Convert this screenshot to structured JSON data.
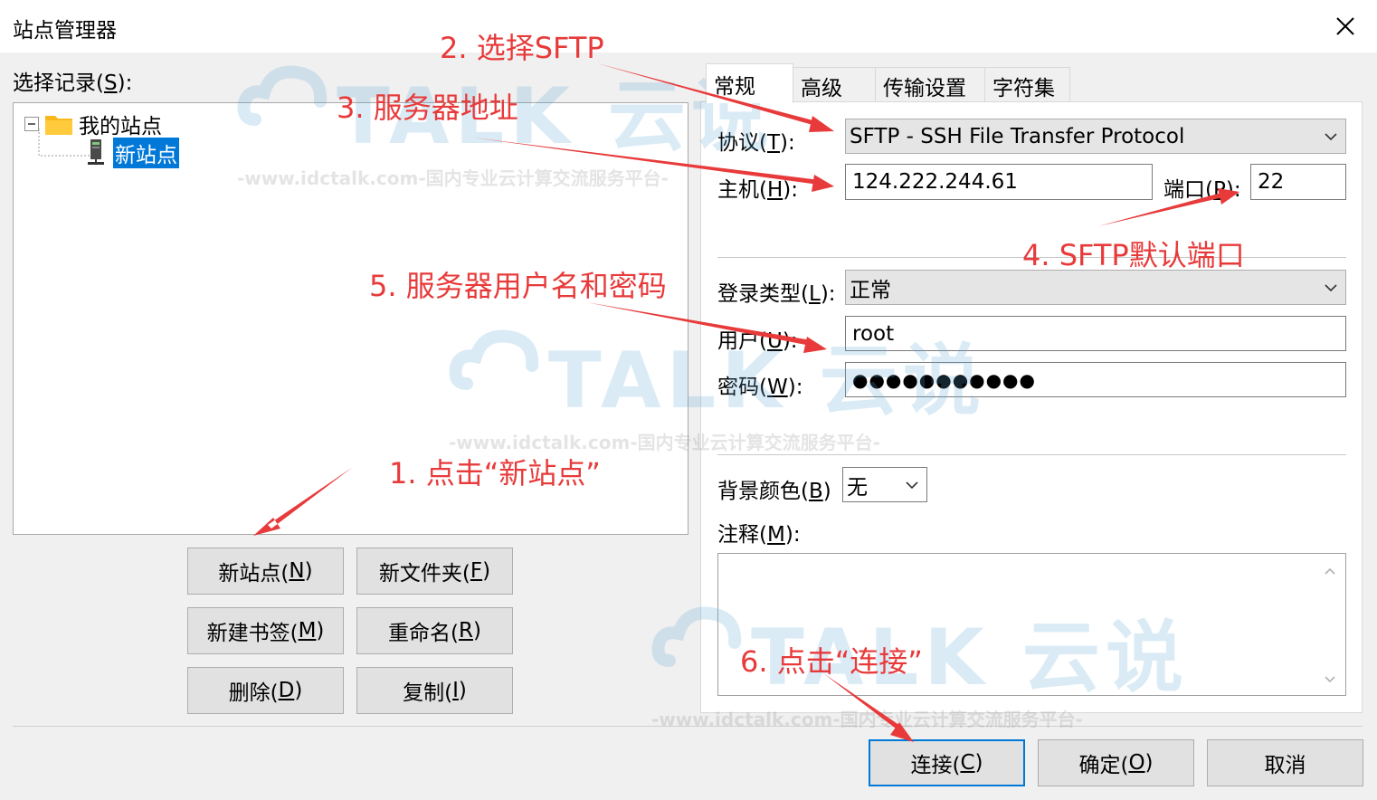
{
  "window": {
    "title": "站点管理器"
  },
  "tree": {
    "label": "选择记录(",
    "label_key": "S",
    "label_end": "):",
    "root": "我的站点",
    "child": "新站点"
  },
  "left_buttons": {
    "new_site": {
      "text": "新站点(",
      "key": "N",
      "end": ")"
    },
    "new_folder": {
      "text": "新文件夹(",
      "key": "F",
      "end": ")"
    },
    "new_bookmark": {
      "text": "新建书签(",
      "key": "M",
      "end": ")"
    },
    "rename": {
      "text": "重命名(",
      "key": "R",
      "end": ")"
    },
    "delete": {
      "text": "删除(",
      "key": "D",
      "end": ")"
    },
    "copy": {
      "text": "复制(",
      "key": "I",
      "end": ")"
    }
  },
  "tabs": [
    "常规",
    "高级",
    "传输设置",
    "字符集"
  ],
  "form": {
    "protocol": {
      "label": "协议(",
      "key": "T",
      "end": "):",
      "value": "SFTP - SSH File Transfer Protocol"
    },
    "host": {
      "label": "主机(",
      "key": "H",
      "end": "):",
      "value": "124.222.244.61"
    },
    "port": {
      "label": "端口(",
      "key": "P",
      "end": "):",
      "value": "22"
    },
    "logon_type": {
      "label": "登录类型(",
      "key": "L",
      "end": "):",
      "value": "正常"
    },
    "user": {
      "label": "用户(",
      "key": "U",
      "end": "):",
      "value": "root"
    },
    "password": {
      "label": "密码(",
      "key": "W",
      "end": "):",
      "value": "●●●●●●●●●●●"
    },
    "bg_color": {
      "label": "背景颜色(",
      "key": "B",
      "end": ")",
      "value": "无"
    },
    "comments": {
      "label": "注释(",
      "key": "M",
      "end": "):"
    }
  },
  "bottom_buttons": {
    "connect": {
      "text": "连接(",
      "key": "C",
      "end": ")"
    },
    "ok": {
      "text": "确定(",
      "key": "O",
      "end": ")"
    },
    "cancel": {
      "text": "取消"
    }
  },
  "annotations": {
    "a1": "1. 点击“新站点”",
    "a2": "2. 选择SFTP",
    "a3": "3. 服务器地址",
    "a4": "4. SFTP默认端口",
    "a5": "5. 服务器用户名和密码",
    "a6": "6. 点击“连接”"
  },
  "watermark": {
    "logo": "TALK 云说",
    "sub": "-www.idctalk.com-国内专业云计算交流服务平台-"
  },
  "colors": {
    "annotation": "#e83a3a",
    "selection": "#0078d7",
    "watermark": "#5aa7d8"
  }
}
